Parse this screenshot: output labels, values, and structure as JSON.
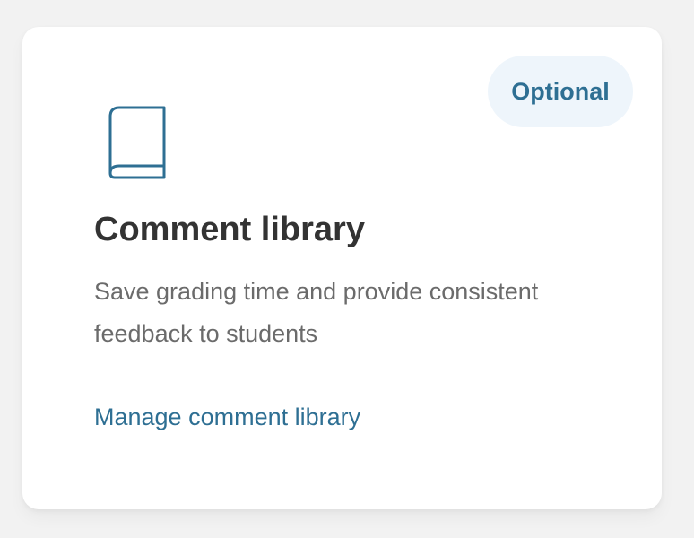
{
  "card": {
    "badge": "Optional",
    "icon": "book-icon",
    "title": "Comment library",
    "description": "Save grading time and provide consistent feedback to students",
    "link_label": "Manage comment library"
  },
  "colors": {
    "accent": "#2e6f93",
    "badge_background": "#eef5fb",
    "title": "#333333",
    "description": "#6b6b6b",
    "page_background": "#f2f2f2",
    "card_background": "#ffffff"
  }
}
